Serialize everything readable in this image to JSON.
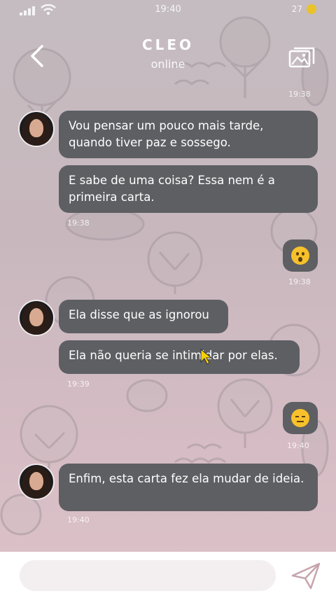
{
  "status_bar": {
    "time": "19:40",
    "battery_text": "27"
  },
  "header": {
    "name": "CLEO",
    "status": "online"
  },
  "messages": [
    {
      "text": "Vou pensar um pouco mais tarde, quando tiver paz e sossego.",
      "from": "cleo"
    },
    {
      "text": "E sabe de uma coisa? Essa nem é a primeira carta.",
      "from": "cleo"
    },
    {
      "text": "Ela disse que as ignorou",
      "from": "cleo"
    },
    {
      "text": "Ela não queria se intimidar por elas.",
      "from": "cleo"
    },
    {
      "text": "Enfim, esta carta fez ela mudar de ideia.",
      "from": "cleo"
    }
  ],
  "timestamps": {
    "top": "19:38",
    "msg2": "19:38",
    "emoji1": "19:38",
    "msg4": "19:39",
    "emoji2": "19:40",
    "msg5": "19:40"
  },
  "emojis": [
    {
      "name": "surprised-face",
      "color": "#f7c12b"
    },
    {
      "name": "neutral-face",
      "color": "#f7c12b"
    }
  ],
  "input": {
    "placeholder": "",
    "value": ""
  },
  "colors": {
    "bubble": "#5d5f63",
    "emoji": "#f7c12b",
    "background": "#c8b8be"
  }
}
